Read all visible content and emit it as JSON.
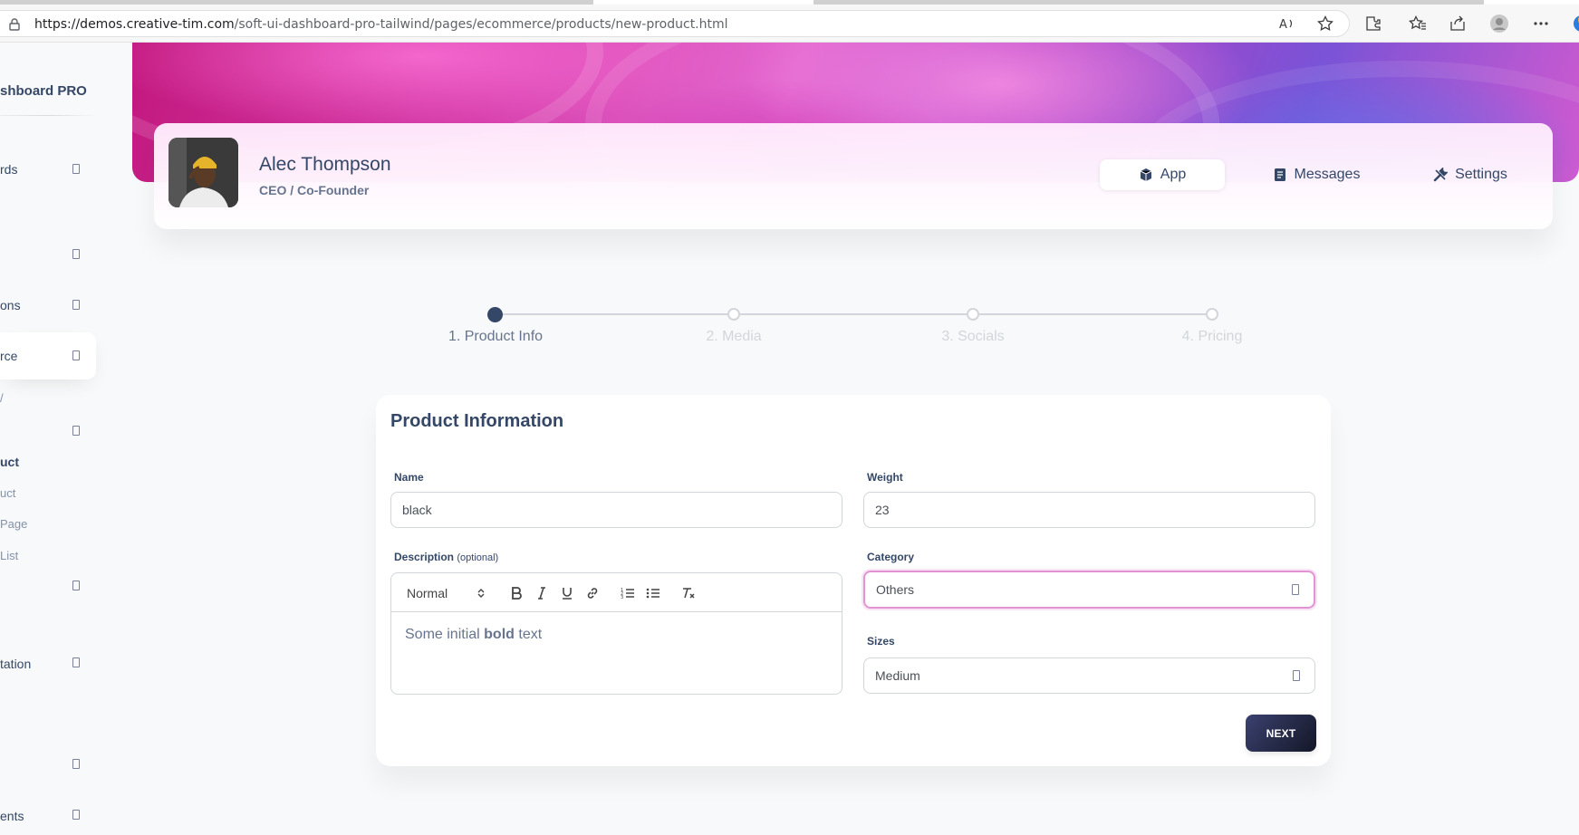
{
  "browser": {
    "url_host": "https://demos.creative-tim.com",
    "url_path": "/soft-ui-dashboard-pro-tailwind/pages/ecommerce/products/new-product.html"
  },
  "sidebar": {
    "brand": "shboard PRO",
    "items": [
      {
        "label": "rds",
        "style": "normal"
      },
      {
        "label": "ons",
        "style": "normal"
      },
      {
        "label": "rce",
        "style": "normal"
      },
      {
        "label": "/",
        "style": "sub"
      },
      {
        "label": "uct",
        "style": "bold"
      },
      {
        "label": "uct",
        "style": "sub"
      },
      {
        "label": "Page",
        "style": "sub"
      },
      {
        "label": "List",
        "style": "sub"
      },
      {
        "label": "tation",
        "style": "normal"
      },
      {
        "label": "ents",
        "style": "normal"
      }
    ]
  },
  "profile": {
    "name": "Alec Thompson",
    "role": "CEO / Co-Founder",
    "tabs": [
      {
        "label": "App",
        "icon": "cube-icon",
        "active": true
      },
      {
        "label": "Messages",
        "icon": "document-icon",
        "active": false
      },
      {
        "label": "Settings",
        "icon": "wrench-icon",
        "active": false
      }
    ]
  },
  "stepper": {
    "steps": [
      "1. Product Info",
      "2. Media",
      "3. Socials",
      "4. Pricing"
    ],
    "active_index": 0
  },
  "form": {
    "title": "Product Information",
    "name_label": "Name",
    "name_value": "black",
    "weight_label": "Weight",
    "weight_value": "23",
    "description_label": "Description",
    "description_optional": "(optional)",
    "editor_format": "Normal",
    "editor_text_pre": "Some initial ",
    "editor_text_bold": "bold",
    "editor_text_post": " text",
    "category_label": "Category",
    "category_value": "Others",
    "sizes_label": "Sizes",
    "sizes_value": "Medium",
    "next_label": "NEXT"
  },
  "colors": {
    "primary_text": "#344767",
    "secondary_text": "#67748e",
    "focus_border": "#e293d3",
    "button_gradient_start": "#141727",
    "button_gradient_end": "#3a416f"
  }
}
